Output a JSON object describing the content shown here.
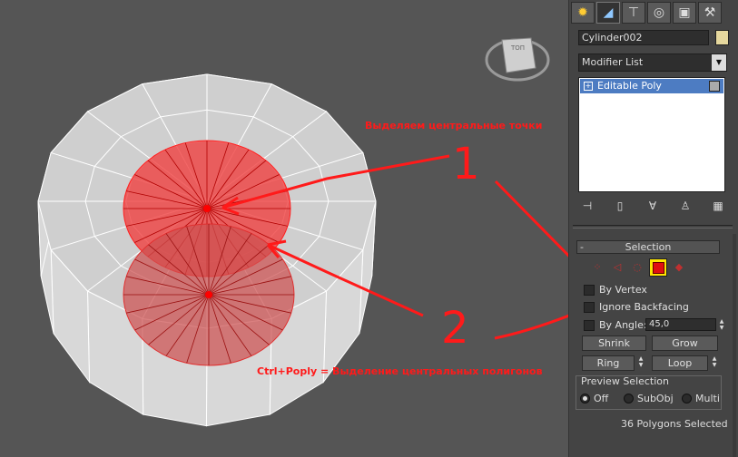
{
  "annotations": {
    "label_1": "Выделяем центральные точки",
    "num_1": "1",
    "num_2": "2",
    "label_2": "Ctrl+Poply = Выделение центральных полигонов"
  },
  "viewcube": {
    "face_label": "ТОП"
  },
  "command_panel": {
    "tabs": [
      "create-icon",
      "modify-icon",
      "hierarchy-icon",
      "motion-icon",
      "display-icon",
      "utilities-icon"
    ],
    "object_name": "Cylinder002",
    "object_color": "#e6d89e",
    "modifier_list": "Modifier List",
    "stack_items": [
      "Editable Poly"
    ],
    "stack_buttons": [
      "pin-stack-icon",
      "show-end-result-icon",
      "make-unique-icon",
      "remove-modifier-icon",
      "configure-sets-icon"
    ]
  },
  "selection_rollout": {
    "title": "Selection",
    "collapse_sign": "-",
    "levels": [
      "vertex",
      "edge",
      "border",
      "polygon",
      "element"
    ],
    "active_level": "polygon",
    "by_vertex": "By Vertex",
    "ignore_backfacing": "Ignore Backfacing",
    "by_angle": "By Angle:",
    "angle_value": "45,0",
    "shrink": "Shrink",
    "grow": "Grow",
    "ring": "Ring",
    "loop": "Loop",
    "preview": {
      "legend": "Preview Selection",
      "off": "Off",
      "subobj": "SubObj",
      "multi": "Multi",
      "selected": "off"
    },
    "status": "36 Polygons Selected"
  },
  "colors": {
    "accent": "#ff1a1a",
    "highlight": "#ffe600",
    "selection_blue": "#4d7cc2"
  }
}
